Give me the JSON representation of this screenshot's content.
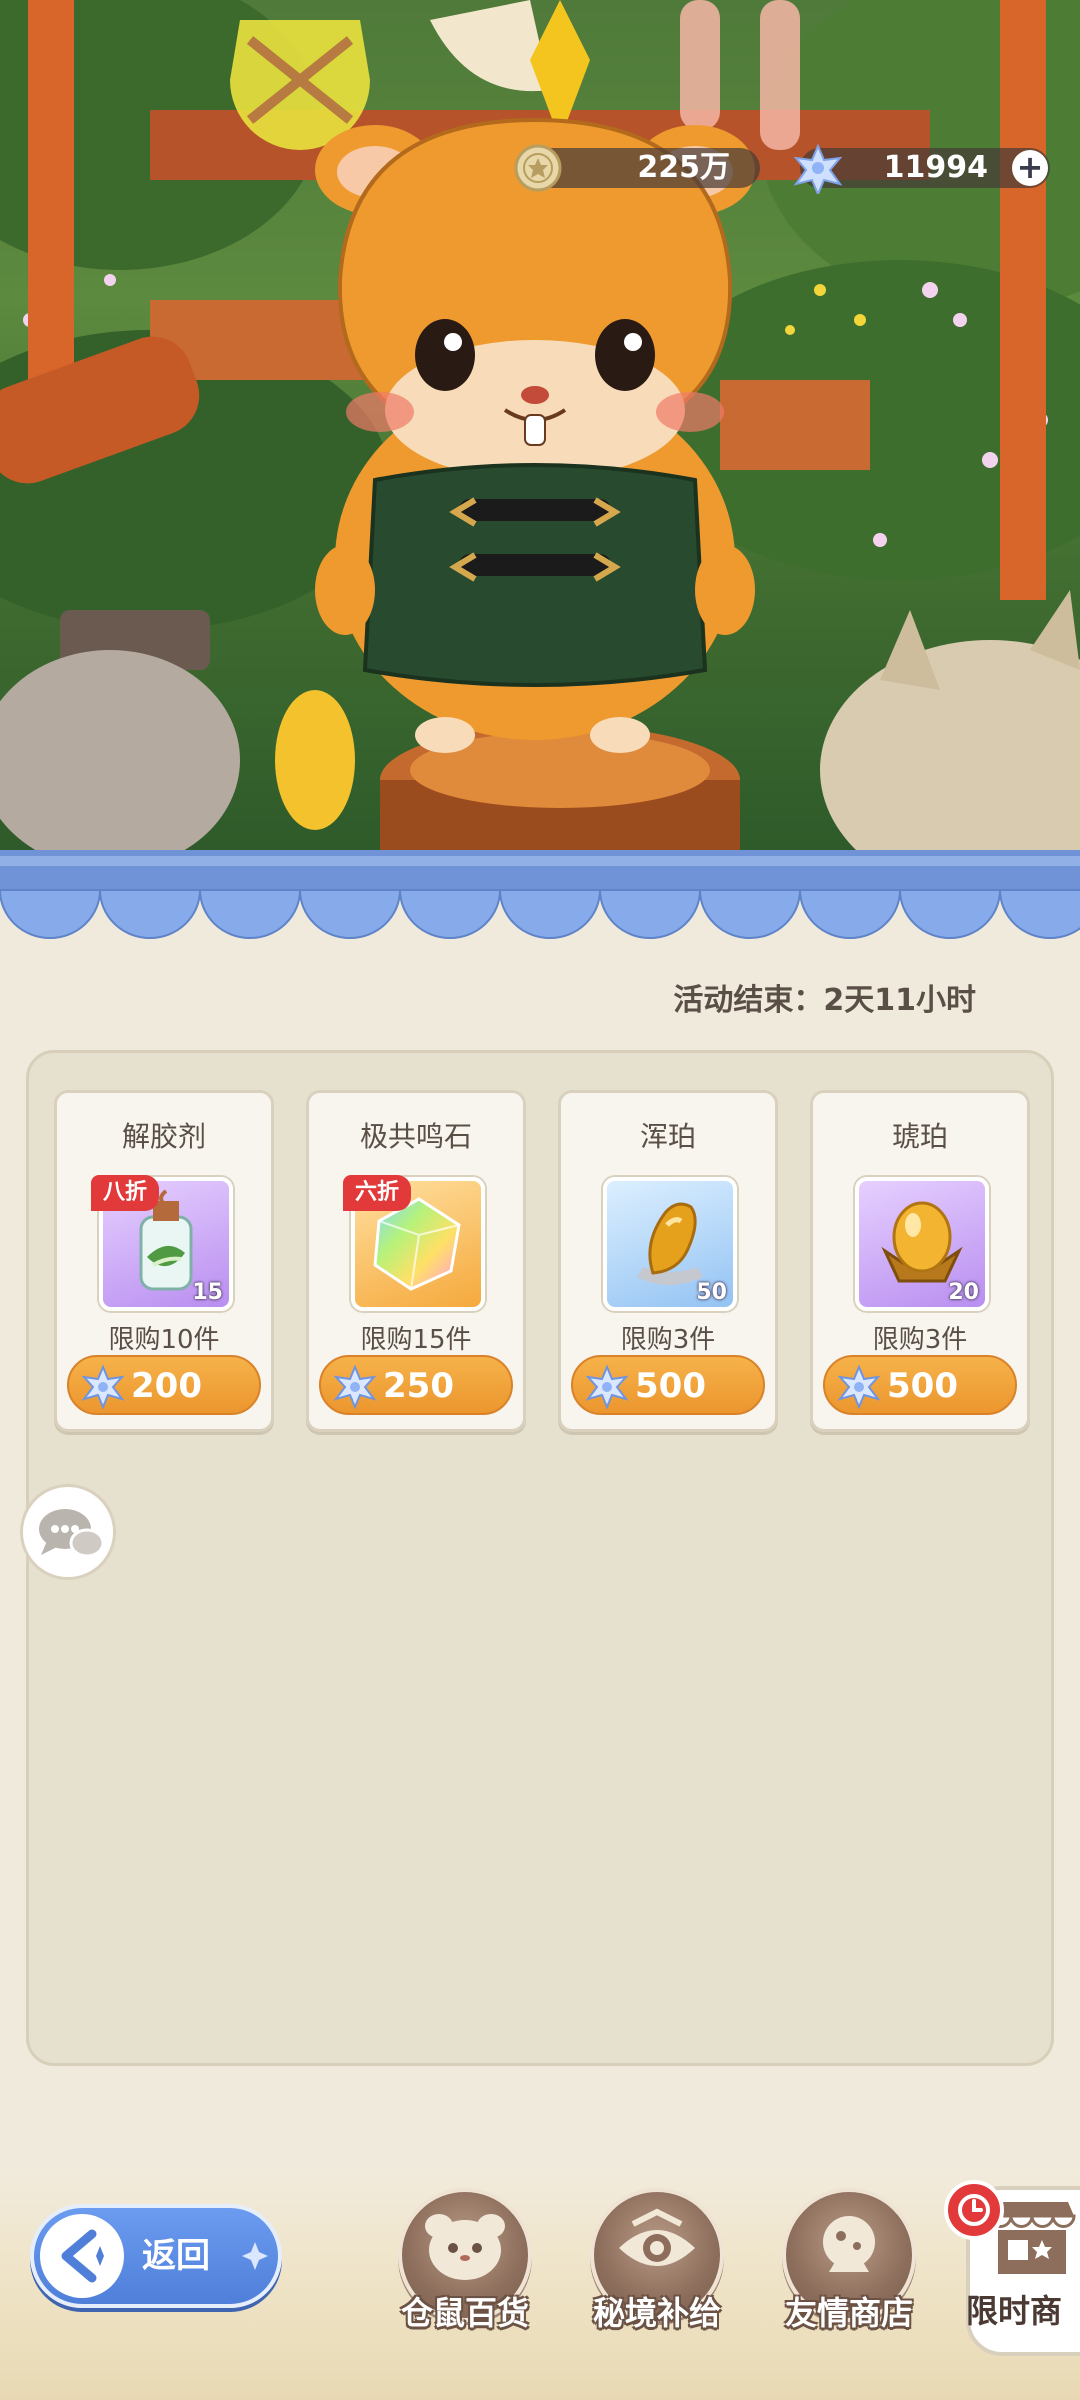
{
  "currency": {
    "coins": {
      "value": "225万",
      "icon": "coin-icon"
    },
    "stars": {
      "value": "11994",
      "icon": "star-crystal-icon",
      "add_label": "+"
    }
  },
  "shop": {
    "event_timer": "活动结束：2天11小时",
    "items": [
      {
        "name": "解胶剂",
        "qty": "15",
        "discount": "八折",
        "limit": "限购10件",
        "price": "200",
        "rarity": "purple",
        "icon": "potion-bottle-icon"
      },
      {
        "name": "极共鸣石",
        "qty": "",
        "discount": "六折",
        "limit": "限购15件",
        "price": "250",
        "rarity": "orange",
        "icon": "rainbow-crystal-icon"
      },
      {
        "name": "浑珀",
        "qty": "50",
        "discount": "",
        "limit": "限购3件",
        "price": "500",
        "rarity": "blue",
        "icon": "amber-chunk-icon"
      },
      {
        "name": "琥珀",
        "qty": "20",
        "discount": "",
        "limit": "限购3件",
        "price": "500",
        "rarity": "purple",
        "icon": "amber-crown-icon"
      }
    ]
  },
  "nav": {
    "back_label": "返回",
    "tabs": [
      {
        "label": "仓鼠百货",
        "icon": "hamster-face-icon"
      },
      {
        "label": "秘境补给",
        "icon": "eye-emblem-icon"
      },
      {
        "label": "友情商店",
        "icon": "crystal-ball-icon"
      },
      {
        "label": "限时商",
        "icon": "shop-stall-icon",
        "active": true
      }
    ]
  },
  "colors": {
    "accent_orange": "#ec962e",
    "back_blue": "#4f7fd9",
    "panel_bg": "#e6e0ce",
    "badge_red": "#e23a3a"
  }
}
